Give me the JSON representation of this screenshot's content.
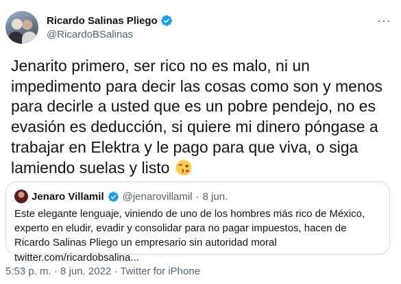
{
  "author": {
    "display_name": "Ricardo Salinas Pliego",
    "handle": "@RicardoBSalinas",
    "verified": true,
    "more_glyph": "···"
  },
  "tweet": {
    "text": "Jenarito primero, ser rico no es malo, ni un impedimento para decir las cosas como son y menos para decirle a usted que es un pobre pendejo, no es evasión es deducción, si quiere mi dinero póngase a trabajar en Elektra y le pago para que viva, o siga lamiendo suelas y listo",
    "emoji": "face-blowing-a-kiss-icon"
  },
  "quoted_tweet": {
    "display_name": "Jenaro Villamil",
    "verified": true,
    "handle": "@jenarovillamil",
    "separator": "·",
    "date": "8 jun.",
    "text": "Este elegante lenguaje, viniendo de uno de los hombres más rico de México, experto en eludir, evadir y consolidar para no pagar impuestos, hacen de Ricardo Salinas Pliego un empresario sin autoridad moral twitter.com/ricardobsalina..."
  },
  "meta": {
    "line": "5:53 p. m. · 8 jun. 2022 · Twitter for iPhone"
  },
  "colors": {
    "verified_blue": "#1d9bf0",
    "secondary_text": "#536471",
    "border": "#cfd9de"
  }
}
